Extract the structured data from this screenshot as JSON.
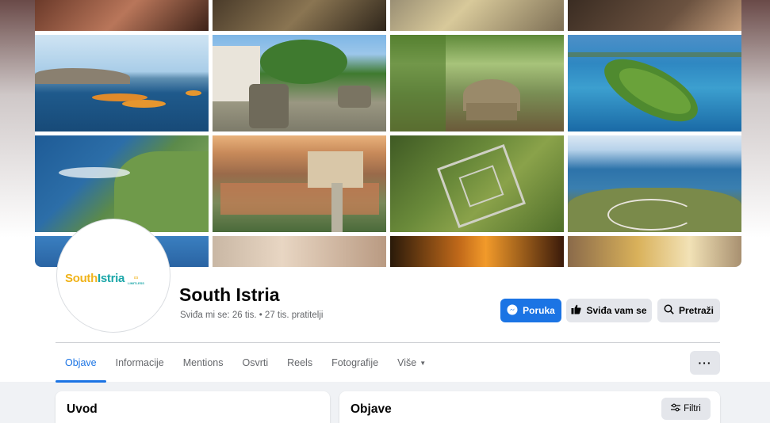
{
  "page": {
    "name": "South Istria",
    "stats": "Sviđa mi se: 26 tis. • 27 tis. pratitelji"
  },
  "logo": {
    "south": "South",
    "istria": "Istria",
    "mark": "∞",
    "tagline": "LIMITLESS"
  },
  "actions": {
    "message_label": "Poruka",
    "like_label": "Sviđa vam se",
    "search_label": "Pretraži"
  },
  "tabs": [
    {
      "label": "Objave",
      "active": true
    },
    {
      "label": "Informacije"
    },
    {
      "label": "Mentions"
    },
    {
      "label": "Osvrti"
    },
    {
      "label": "Reels"
    },
    {
      "label": "Fotografije"
    },
    {
      "label": "Više",
      "dropdown": true
    }
  ],
  "more_button": "···",
  "intro_card": {
    "title": "Uvod"
  },
  "posts_card": {
    "title": "Objave",
    "filter_label": "Filtri"
  },
  "icons": {
    "message": "messenger-icon",
    "like": "thumbs-up-icon",
    "search": "search-icon",
    "filter": "sliders-icon",
    "more": "ellipsis-icon"
  },
  "colors": {
    "accent": "#1b74e4",
    "secondary_button": "#e4e6eb",
    "background": "#f0f2f5",
    "logo_yellow": "#f0b31a",
    "logo_teal": "#1aa6a8"
  }
}
